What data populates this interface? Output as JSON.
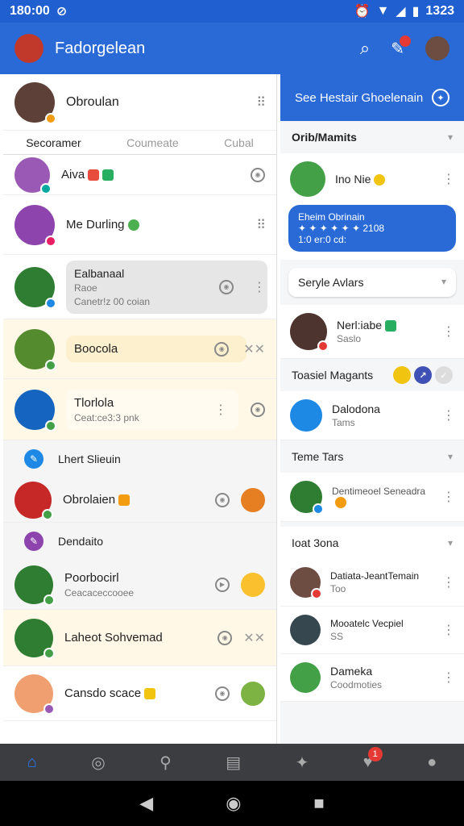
{
  "status": {
    "time": "180:00",
    "right_time": "1323"
  },
  "appbar": {
    "title": "Fadorgelean"
  },
  "left": {
    "header": {
      "name": "Obroulan"
    },
    "tabs": [
      "Secoramer",
      "Coumeate",
      "Cubal"
    ],
    "rows": [
      {
        "name": "Aiva"
      },
      {
        "name": "Me Durling"
      },
      {
        "name": "Ealbanaal",
        "sub1": "Raoe",
        "sub2": "Canetr!z 00 coian"
      },
      {
        "name": "Boocola"
      },
      {
        "name": "Tlorlola",
        "sub": "Ceat:ce3:3 pnk"
      }
    ],
    "section1": "Lhert Slieuin",
    "row6": {
      "name": "Obrolaien"
    },
    "section2": "Dendaito",
    "row7": {
      "name": "Poorbocirl",
      "sub": "Ceacaceccooee"
    },
    "row8": {
      "name": "Laheot Sohvemad"
    },
    "row9": {
      "name": "Cansdo scace"
    }
  },
  "right": {
    "button": "See Hestair Ghoelenain",
    "sec1": "Orib/Mamits",
    "card1": {
      "name": "Ino Nie"
    },
    "bubble": {
      "line1": "Eheim Obrinain",
      "line2": "2108",
      "line3": "1:0 er:0 cd:"
    },
    "dropdown": "Seryle Avlars",
    "card2": {
      "name": "Nerl:iabe",
      "sub": "Saslo"
    },
    "sec2": "Toasiel Magants",
    "card3": {
      "name": "Dalodona",
      "sub": "Tams"
    },
    "sec3": "Teme Tars",
    "card4": {
      "name": "Dentimeoel Seneadra"
    },
    "sec4": "Ioat 3ona",
    "card5": {
      "name": "Datiata-JeantTemain",
      "sub": "Too"
    },
    "card6": {
      "name": "Mooatelc Vecpiel",
      "sub": "SS"
    },
    "card7": {
      "name": "Dameka",
      "sub": "Coodmoties"
    }
  },
  "nav": {
    "badge": "1"
  }
}
